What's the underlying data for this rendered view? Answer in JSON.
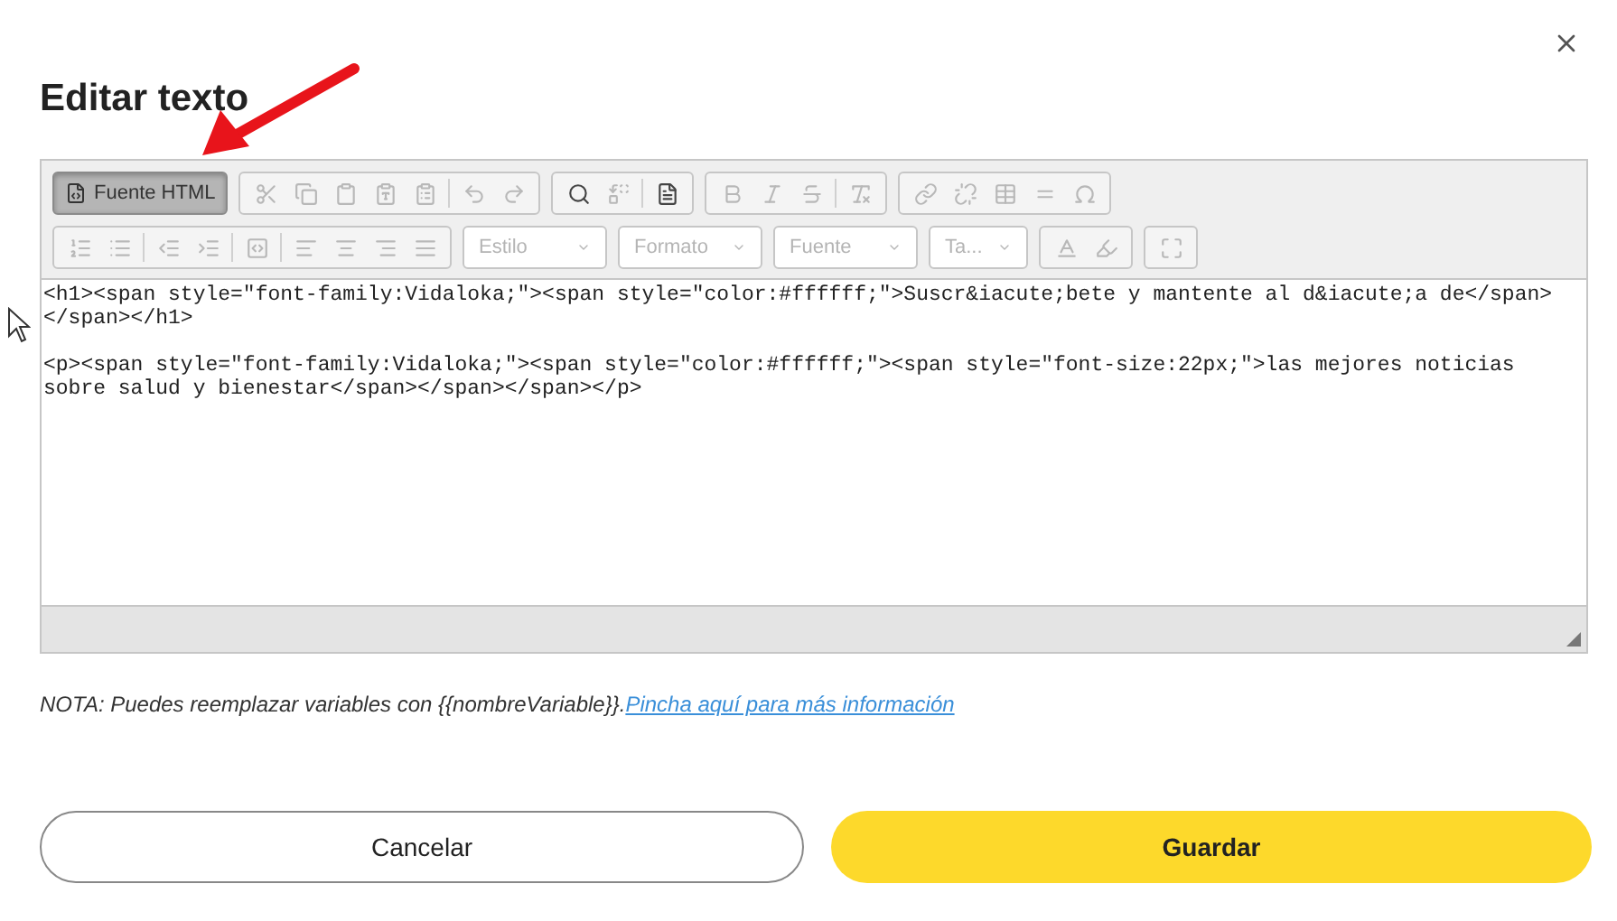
{
  "dialog": {
    "title": "Editar texto"
  },
  "toolbar": {
    "rows": [
      {
        "groups": [
          {
            "kind": "source",
            "label": "Fuente HTML",
            "selected": true
          },
          {
            "kind": "buttons",
            "items": [
              {
                "kind": "cut",
                "disabled": true
              },
              {
                "kind": "copy",
                "disabled": true
              },
              {
                "kind": "paste",
                "disabled": true
              },
              {
                "kind": "paste-text",
                "disabled": true
              },
              {
                "kind": "paste-word",
                "disabled": true
              },
              {
                "kind": "separator"
              },
              {
                "kind": "undo",
                "disabled": true
              },
              {
                "kind": "redo",
                "disabled": true
              }
            ]
          },
          {
            "kind": "buttons",
            "items": [
              {
                "kind": "find",
                "disabled": false
              },
              {
                "kind": "replace",
                "disabled": true
              },
              {
                "kind": "separator"
              },
              {
                "kind": "templates",
                "disabled": false
              }
            ]
          },
          {
            "kind": "buttons",
            "items": [
              {
                "kind": "bold",
                "disabled": true
              },
              {
                "kind": "italic",
                "disabled": true
              },
              {
                "kind": "strike",
                "disabled": true
              },
              {
                "kind": "separator"
              },
              {
                "kind": "remove-format",
                "disabled": true
              }
            ]
          },
          {
            "kind": "buttons",
            "items": [
              {
                "kind": "link",
                "disabled": true
              },
              {
                "kind": "unlink",
                "disabled": true
              },
              {
                "kind": "table",
                "disabled": true
              },
              {
                "kind": "rule",
                "disabled": true
              },
              {
                "kind": "omega",
                "disabled": true
              }
            ]
          }
        ]
      },
      {
        "groups": [
          {
            "kind": "buttons",
            "items": [
              {
                "kind": "numbered-list",
                "disabled": true
              },
              {
                "kind": "bulleted-list",
                "disabled": true
              },
              {
                "kind": "separator"
              },
              {
                "kind": "outdent",
                "disabled": true
              },
              {
                "kind": "indent",
                "disabled": true
              },
              {
                "kind": "separator"
              },
              {
                "kind": "div",
                "disabled": true
              },
              {
                "kind": "separator"
              },
              {
                "kind": "align-left",
                "disabled": true
              },
              {
                "kind": "align-center",
                "disabled": true
              },
              {
                "kind": "align-right",
                "disabled": true
              },
              {
                "kind": "justify",
                "disabled": true
              }
            ]
          },
          {
            "kind": "dropdown",
            "label": "Estilo",
            "disabled": true
          },
          {
            "kind": "dropdown",
            "label": "Formato",
            "disabled": true
          },
          {
            "kind": "dropdown",
            "label": "Fuente",
            "disabled": true
          },
          {
            "kind": "dropdown",
            "label": "Ta...",
            "disabled": true
          },
          {
            "kind": "buttons",
            "items": [
              {
                "kind": "text-color",
                "disabled": true
              },
              {
                "kind": "background-color",
                "disabled": true
              }
            ]
          },
          {
            "kind": "buttons",
            "items": [
              {
                "kind": "maximize",
                "disabled": true
              }
            ]
          }
        ]
      }
    ]
  },
  "source_code": [
    "<h1><span style=\"font-family:Vidaloka;\"><span style=\"color:#ffffff;\">Suscr&iacute;bete y mantente al d&iacute;a de</span></span></h1>",
    "<p><span style=\"font-family:Vidaloka;\"><span style=\"color:#ffffff;\"><span style=\"font-size:22px;\">las mejores noticias sobre salud y bienestar</span></span></span></p>"
  ],
  "note": {
    "text": "NOTA: Puedes reemplazar variables con {{nombreVariable}}.",
    "link": "Pincha aquí para más información"
  },
  "buttons": [
    {
      "kind": "secondary",
      "label": "Cancelar"
    },
    {
      "kind": "primary",
      "label": "Guardar"
    }
  ]
}
